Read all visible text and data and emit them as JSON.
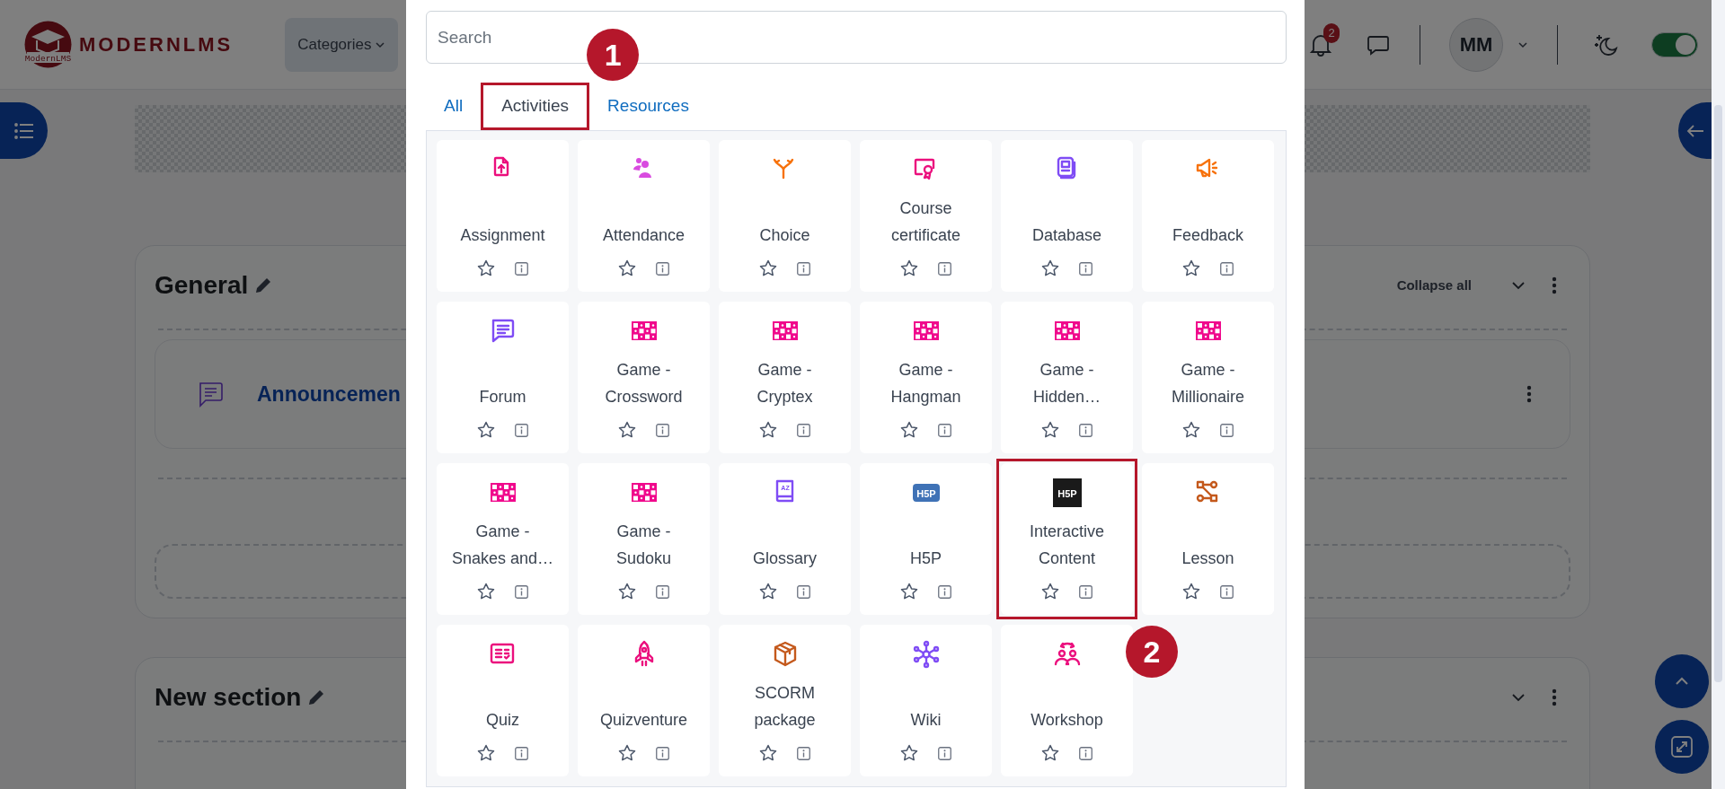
{
  "header": {
    "logo_text": "MODERNLMS",
    "logo_badge_text": "ModernLMS",
    "nav": [
      {
        "label": "Categories"
      }
    ],
    "notifications": {
      "count": "2"
    },
    "avatar": {
      "initials": "MM"
    },
    "theme_toggle": {
      "on": true
    }
  },
  "page": {
    "sections": [
      {
        "title": "General",
        "header_action": "Collapse all",
        "activities": [
          {
            "title": "Announcemen"
          }
        ]
      },
      {
        "title": "New section"
      }
    ]
  },
  "modal": {
    "search": {
      "placeholder": "Search"
    },
    "tabs": [
      {
        "label": "All",
        "selected": false,
        "highlighted": false
      },
      {
        "label": "Activities",
        "selected": true,
        "highlighted": true,
        "callout": "1"
      },
      {
        "label": "Resources",
        "selected": false,
        "highlighted": false
      }
    ],
    "activities": [
      {
        "name": "Assignment",
        "kind": "upload",
        "color": "#eb0f7d",
        "starred": false,
        "highlighted": false
      },
      {
        "name": "Attendance",
        "kind": "attendance",
        "color": "#d94be0",
        "starred": false,
        "highlighted": false
      },
      {
        "name": "Choice",
        "kind": "choice",
        "color": "#f7720c",
        "starred": false,
        "highlighted": false
      },
      {
        "name": "Course certificate",
        "kind": "certificate",
        "color": "#eb0f7d",
        "starred": false,
        "highlighted": false
      },
      {
        "name": "Database",
        "kind": "database",
        "color": "#7f4cf5",
        "starred": false,
        "highlighted": false
      },
      {
        "name": "Feedback",
        "kind": "feedback",
        "color": "#f7720c",
        "starred": false,
        "highlighted": false
      },
      {
        "name": "Forum",
        "kind": "forum",
        "color": "#7f4cf5",
        "starred": false,
        "highlighted": false
      },
      {
        "name": "Game - Crossword",
        "kind": "game",
        "color": "#f0088c",
        "starred": false,
        "highlighted": false
      },
      {
        "name": "Game - Cryptex",
        "kind": "game",
        "color": "#f0088c",
        "starred": false,
        "highlighted": false
      },
      {
        "name": "Game - Hangman",
        "kind": "game",
        "color": "#f0088c",
        "starred": false,
        "highlighted": false
      },
      {
        "name": "Game - Hidden…",
        "kind": "game",
        "color": "#f0088c",
        "starred": false,
        "highlighted": false
      },
      {
        "name": "Game - Millionaire",
        "kind": "game",
        "color": "#f0088c",
        "starred": false,
        "highlighted": false
      },
      {
        "name": "Game - Snakes and…",
        "kind": "game",
        "color": "#f0088c",
        "starred": false,
        "highlighted": false
      },
      {
        "name": "Game - Sudoku",
        "kind": "game",
        "color": "#f0088c",
        "starred": false,
        "highlighted": false
      },
      {
        "name": "Glossary",
        "kind": "glossary",
        "icon_text": "AZ",
        "color": "#7f4cf5",
        "starred": false,
        "highlighted": false
      },
      {
        "name": "H5P",
        "kind": "h5p",
        "icon_text": "H5P",
        "color": "#3f72b6",
        "starred": false,
        "highlighted": false
      },
      {
        "name": "Interactive Content",
        "kind": "h5p-dark",
        "icon_text": "H5P",
        "color": "#1a1a1a",
        "starred": false,
        "highlighted": true,
        "callout": "2"
      },
      {
        "name": "Lesson",
        "kind": "lesson",
        "color": "#c4591c",
        "starred": false,
        "highlighted": false
      },
      {
        "name": "Quiz",
        "kind": "quiz",
        "color": "#eb0f7d",
        "starred": false,
        "highlighted": false
      },
      {
        "name": "Quizventure",
        "kind": "rocket",
        "color": "#eb0f7d",
        "starred": false,
        "highlighted": false
      },
      {
        "name": "SCORM package",
        "kind": "package",
        "color": "#c4591c",
        "starred": false,
        "highlighted": false
      },
      {
        "name": "Wiki",
        "kind": "wiki",
        "color": "#7f4cf5",
        "starred": false,
        "highlighted": false
      },
      {
        "name": "Workshop",
        "kind": "workshop",
        "color": "#eb0f7d",
        "starred": false,
        "highlighted": false
      }
    ]
  }
}
